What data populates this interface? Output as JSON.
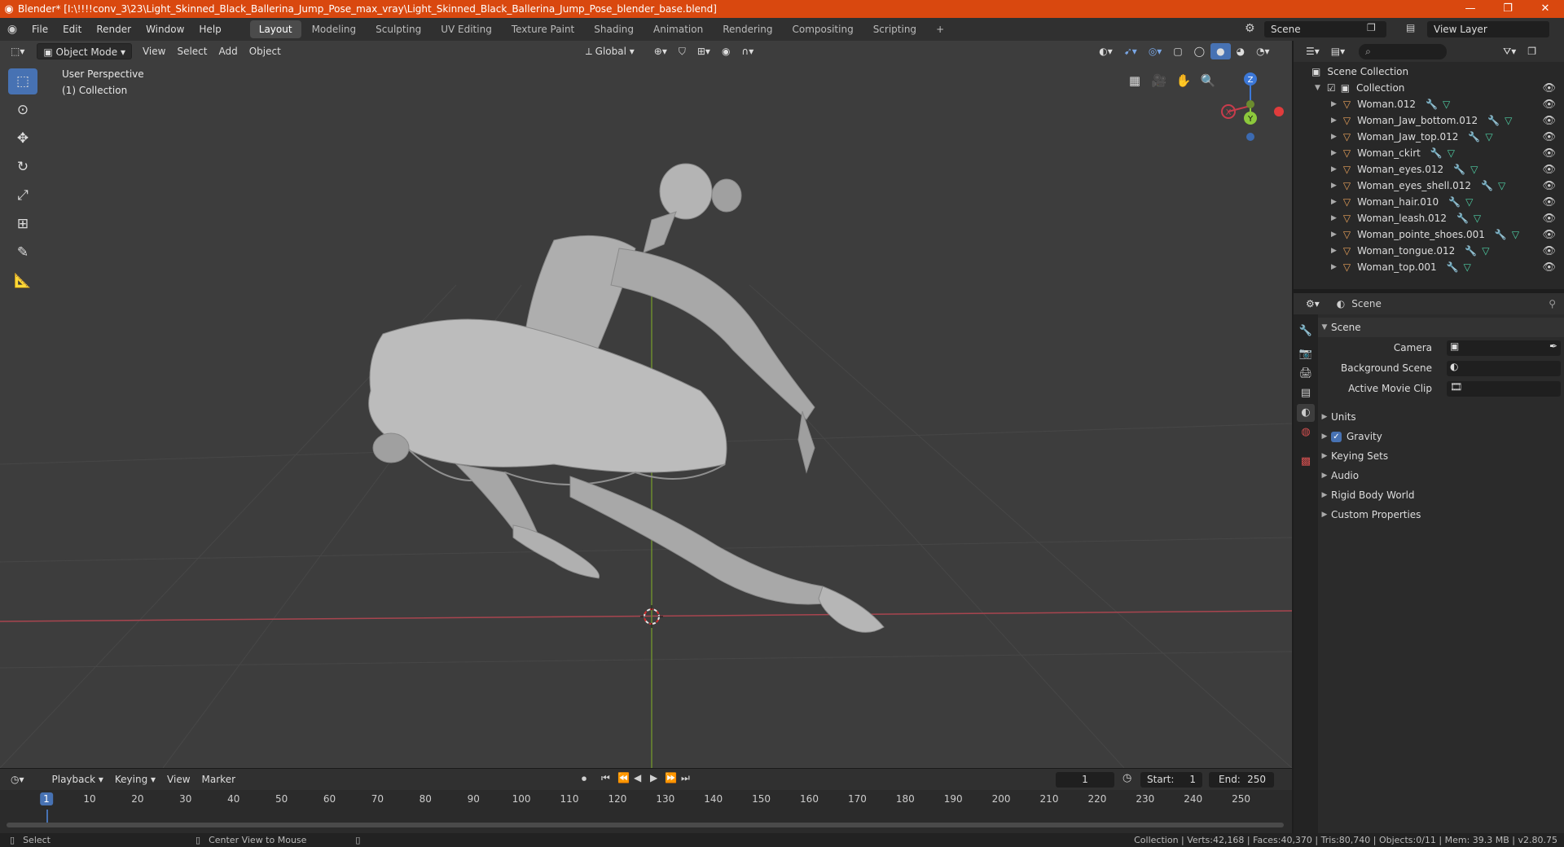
{
  "window": {
    "title": "Blender* [I:\\!!!!conv_3\\23\\Light_Skinned_Black_Ballerina_Jump_Pose_max_vray\\Light_Skinned_Black_Ballerina_Jump_Pose_blender_base.blend]",
    "minimize": "—",
    "restore": "❐",
    "close": "✕"
  },
  "menu": {
    "items": [
      "File",
      "Edit",
      "Render",
      "Window",
      "Help"
    ],
    "workspaces": [
      "Layout",
      "Modeling",
      "Sculpting",
      "UV Editing",
      "Texture Paint",
      "Shading",
      "Animation",
      "Rendering",
      "Compositing",
      "Scripting"
    ],
    "active_workspace": "Layout",
    "add_tab": "+",
    "scene": "Scene",
    "view_layer": "View Layer"
  },
  "viewport": {
    "mode": "Object Mode",
    "menus": [
      "View",
      "Select",
      "Add",
      "Object"
    ],
    "orientation": "Global",
    "perspective_label": "User Perspective",
    "collection_label": "(1) Collection",
    "gizmo": {
      "x": "X",
      "y": "Y",
      "z": "Z"
    }
  },
  "timeline": {
    "menus": [
      "Playback",
      "Keying",
      "View",
      "Marker"
    ],
    "current_frame": "1",
    "start_label": "Start:",
    "start": "1",
    "end_label": "End:",
    "end": "250",
    "ticks": [
      "1",
      "10",
      "20",
      "30",
      "40",
      "50",
      "60",
      "70",
      "80",
      "90",
      "100",
      "110",
      "120",
      "130",
      "140",
      "150",
      "160",
      "170",
      "180",
      "190",
      "200",
      "210",
      "220",
      "230",
      "240",
      "250"
    ]
  },
  "statusbar": {
    "select": "Select",
    "center_view": "Center View to Mouse",
    "stats": "Collection | Verts:42,168 | Faces:40,370 | Tris:80,740 | Objects:0/11 | Mem: 39.3 MB | v2.80.75"
  },
  "outliner": {
    "scene_collection": "Scene Collection",
    "collection": "Collection",
    "objects": [
      "Woman.012",
      "Woman_Jaw_bottom.012",
      "Woman_Jaw_top.012",
      "Woman_ckirt",
      "Woman_eyes.012",
      "Woman_eyes_shell.012",
      "Woman_hair.010",
      "Woman_leash.012",
      "Woman_pointe_shoes.001",
      "Woman_tongue.012",
      "Woman_top.001"
    ]
  },
  "properties": {
    "context": "Scene",
    "panel_title": "Scene",
    "camera_label": "Camera",
    "background_scene_label": "Background Scene",
    "active_movie_clip_label": "Active Movie Clip",
    "panels": [
      "Units",
      "Gravity",
      "Keying Sets",
      "Audio",
      "Rigid Body World",
      "Custom Properties"
    ],
    "gravity_enabled": true
  },
  "colors": {
    "title_bar": "#d9480f",
    "accent": "#4772b3",
    "viewport_bg": "#3d3d3d",
    "x_axis": "#c83c4c",
    "y_axis": "#8cc83c",
    "z_axis": "#3c78d8"
  }
}
